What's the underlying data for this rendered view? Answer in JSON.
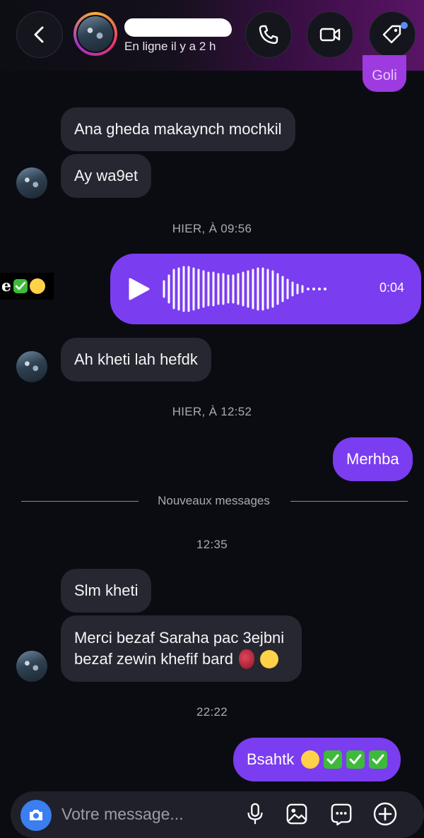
{
  "header": {
    "contact_status": "En ligne il y a 2 h",
    "back_icon": "chevron-left-icon",
    "call_icon": "phone-icon",
    "video_icon": "video-camera-icon",
    "tag_icon": "tag-icon"
  },
  "messages": {
    "top_outgoing_partial": "Goli",
    "in_1": "Ana gheda makaynch mochkil",
    "in_2": "Ay wa9et",
    "ts_1": "HIER, À 09:56",
    "left_overflow_text": "e",
    "voice_duration": "0:04",
    "in_3": "Ah kheti lah hefdk",
    "ts_2": "HIER, À 12:52",
    "out_1": "Merhba",
    "new_messages_divider": "Nouveaux messages",
    "ts_3": "12:35",
    "in_4": "Slm kheti",
    "in_5_line1": "Merci bezaf Saraha pac 3ejbni",
    "in_5_line2": "bezaf zewin khefif bard",
    "ts_4": "22:22",
    "out_2": "Bsahtk"
  },
  "composer": {
    "placeholder": "Votre message...",
    "camera_icon": "camera-icon",
    "mic_icon": "microphone-icon",
    "gallery_icon": "image-icon",
    "sticker_icon": "chat-sticker-icon",
    "plus_icon": "plus-icon"
  },
  "colors": {
    "background": "#0b0c12",
    "incoming_bubble": "#262730",
    "outgoing_bubble": "#7b3df0",
    "camera_button": "#3b7ef0"
  }
}
